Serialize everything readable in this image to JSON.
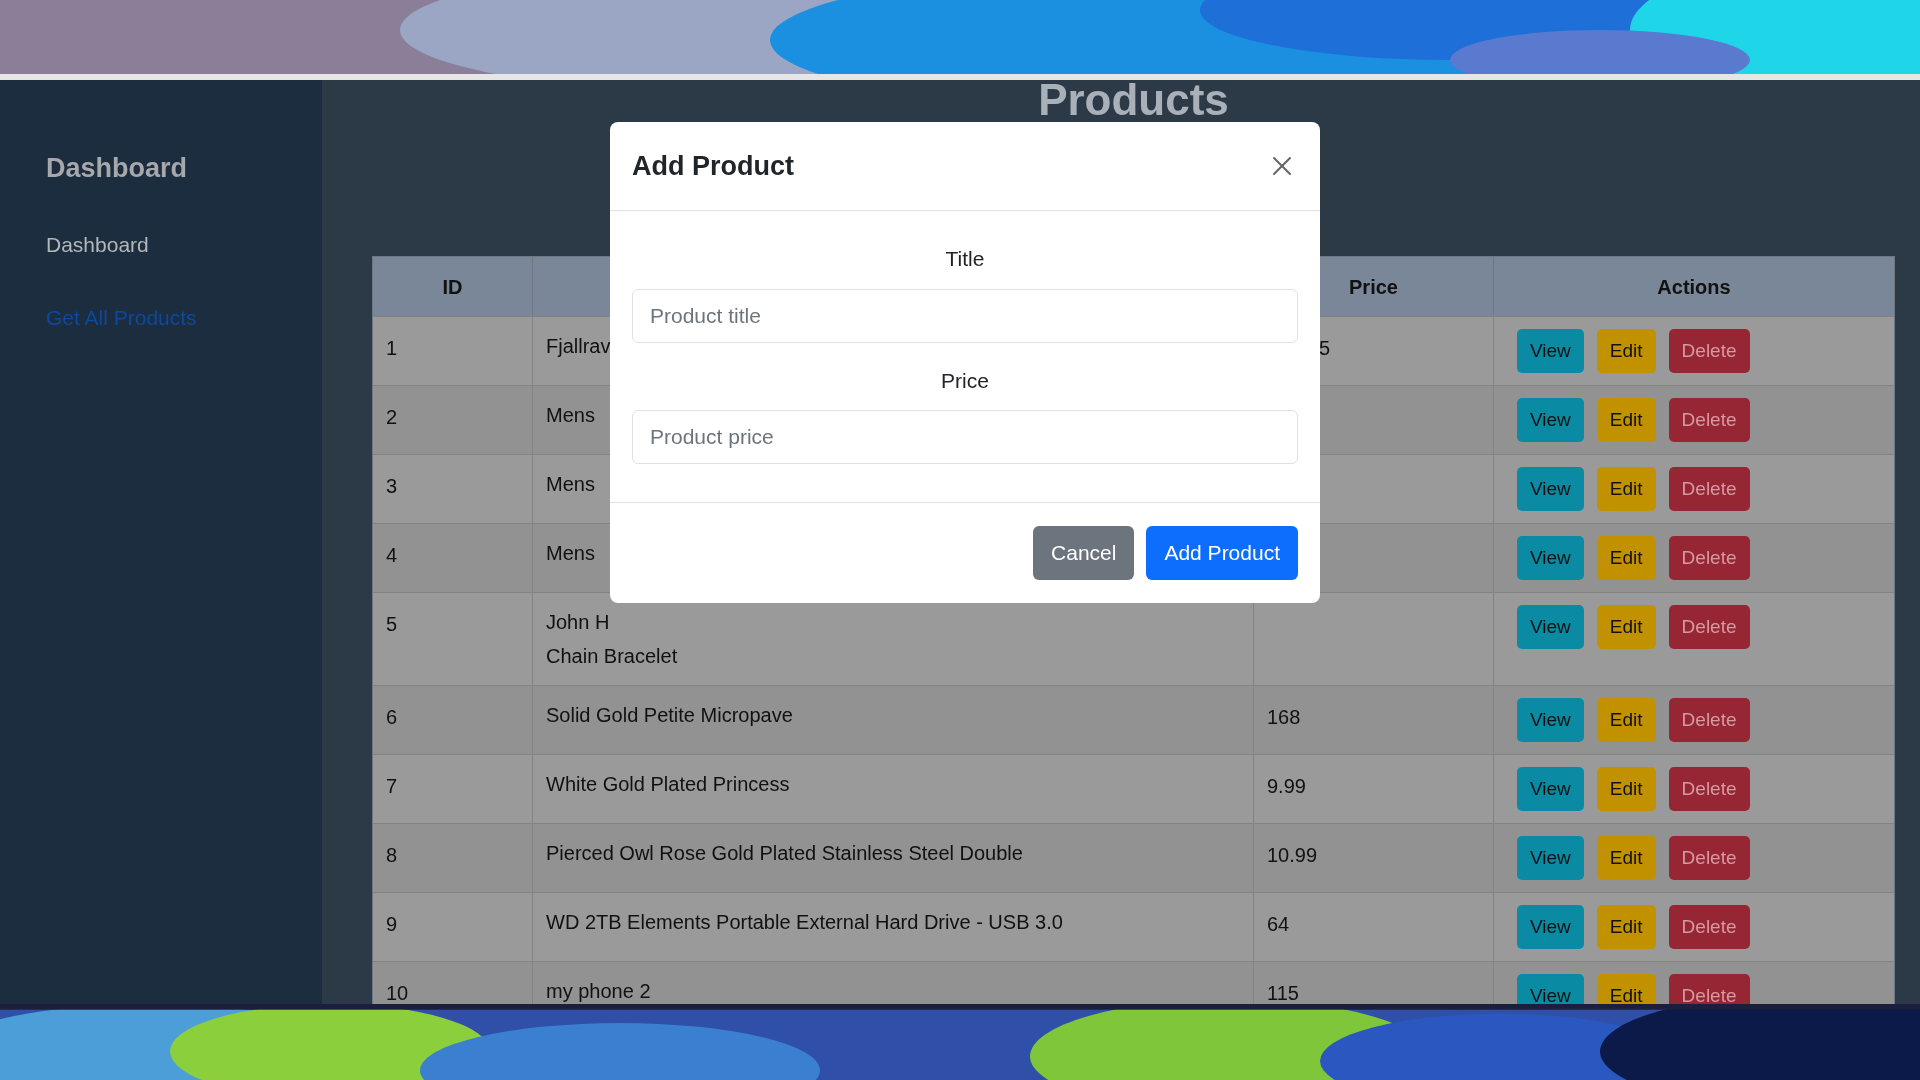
{
  "sidebar": {
    "brand": "Dashboard",
    "items": [
      {
        "label": "Dashboard",
        "kind": "plain"
      },
      {
        "label": "Get All Products",
        "kind": "link"
      }
    ]
  },
  "page_title": "Products",
  "table": {
    "id_header": "ID",
    "price_header": "Price",
    "actions_header": "Actions",
    "rows": [
      {
        "id": "1",
        "title": [
          "Fjallrav"
        ],
        "price": "5",
        "actions": [
          {
            "label": "View",
            "kind": "view"
          },
          {
            "label": "Edit",
            "kind": "edit"
          },
          {
            "label": "Delete",
            "kind": "delete"
          }
        ]
      },
      {
        "id": "2",
        "title": [
          "Mens"
        ],
        "actions": [
          {
            "label": "View",
            "kind": "view"
          },
          {
            "label": "Edit",
            "kind": "edit"
          },
          {
            "label": "Delete",
            "kind": "delete"
          }
        ]
      },
      {
        "id": "3",
        "title": [
          "Mens"
        ],
        "actions": [
          {
            "label": "View",
            "kind": "view"
          },
          {
            "label": "Edit",
            "kind": "edit"
          },
          {
            "label": "Delete",
            "kind": "delete"
          }
        ]
      },
      {
        "id": "4",
        "title": [
          "Mens"
        ],
        "actions": [
          {
            "label": "View",
            "kind": "view"
          },
          {
            "label": "Edit",
            "kind": "edit"
          },
          {
            "label": "Delete",
            "kind": "delete"
          }
        ]
      },
      {
        "id": "5",
        "title": [
          "John H",
          "Chain Bracelet"
        ],
        "actions": [
          {
            "label": "View",
            "kind": "view"
          },
          {
            "label": "Edit",
            "kind": "edit"
          },
          {
            "label": "Delete",
            "kind": "delete"
          }
        ]
      },
      {
        "id": "6",
        "title": [
          "Solid Gold Petite Micropave"
        ],
        "price": "168",
        "actions": [
          {
            "label": "View",
            "kind": "view"
          },
          {
            "label": "Edit",
            "kind": "edit"
          },
          {
            "label": "Delete",
            "kind": "delete"
          }
        ]
      },
      {
        "id": "7",
        "title": [
          "White Gold Plated Princess"
        ],
        "price": "9.99",
        "actions": [
          {
            "label": "View",
            "kind": "view"
          },
          {
            "label": "Edit",
            "kind": "edit"
          },
          {
            "label": "Delete",
            "kind": "delete"
          }
        ]
      },
      {
        "id": "8",
        "title": [
          "Pierced Owl Rose Gold Plated Stainless Steel Double"
        ],
        "price": "10.99",
        "actions": [
          {
            "label": "View",
            "kind": "view"
          },
          {
            "label": "Edit",
            "kind": "edit"
          },
          {
            "label": "Delete",
            "kind": "delete"
          }
        ]
      },
      {
        "id": "9",
        "title": [
          "WD 2TB Elements Portable External Hard Drive - USB 3.0"
        ],
        "price": "64",
        "actions": [
          {
            "label": "View",
            "kind": "view"
          },
          {
            "label": "Edit",
            "kind": "edit"
          },
          {
            "label": "Delete",
            "kind": "delete"
          }
        ]
      },
      {
        "id": "10",
        "title": [
          "my phone 2"
        ],
        "price": "115",
        "actions": [
          {
            "label": "View",
            "kind": "view"
          },
          {
            "label": "Edit",
            "kind": "edit"
          },
          {
            "label": "Delete",
            "kind": "delete"
          }
        ]
      }
    ]
  },
  "modal": {
    "title": "Add Product",
    "fields": [
      {
        "label": "Title",
        "placeholder": "Product title"
      },
      {
        "label": "Price",
        "placeholder": "Product price"
      }
    ],
    "buttons": [
      {
        "label": "Cancel",
        "kind": "secondary"
      },
      {
        "label": "Add Product",
        "kind": "primary"
      }
    ]
  }
}
